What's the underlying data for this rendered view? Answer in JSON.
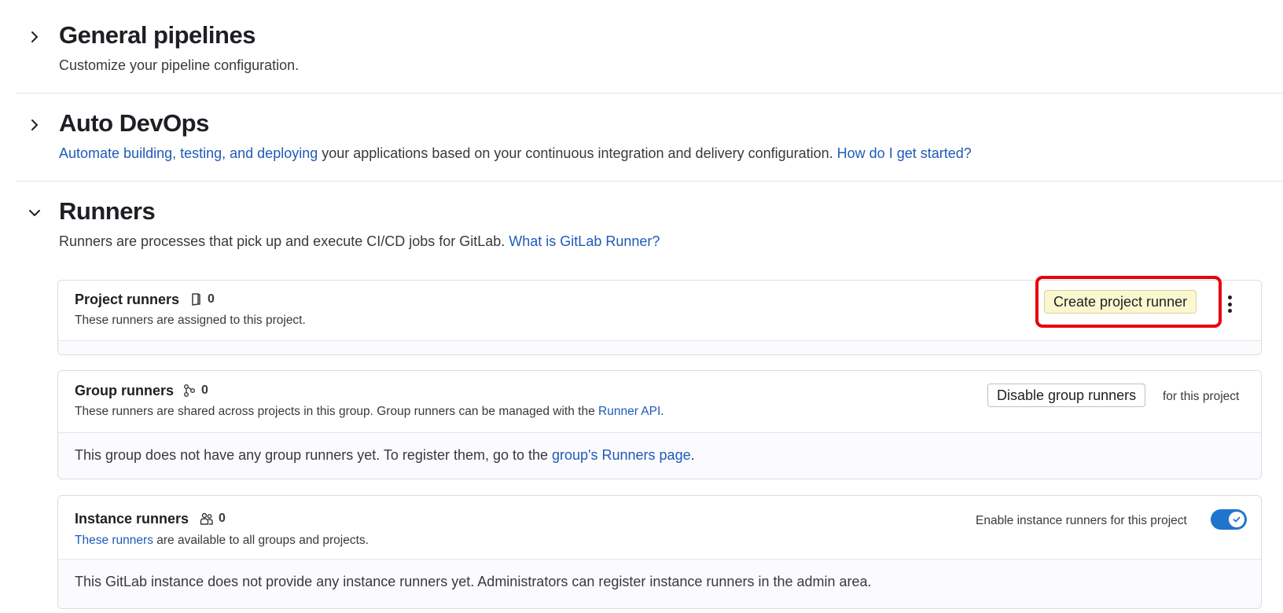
{
  "sections": {
    "general": {
      "title": "General pipelines",
      "description": "Customize your pipeline configuration."
    },
    "autodevops": {
      "title": "Auto DevOps",
      "link1": "Automate building, testing, and deploying",
      "text": " your applications based on your continuous integration and delivery configuration. ",
      "link2": "How do I get started?"
    },
    "runners": {
      "title": "Runners",
      "text": "Runners are processes that pick up and execute CI/CD jobs for GitLab. ",
      "link": "What is GitLab Runner?"
    }
  },
  "project_runners": {
    "title": "Project runners",
    "count": "0",
    "subtitle": "These runners are assigned to this project.",
    "create_button": "Create project runner",
    "more_actions_icon": "vertical-ellipsis-icon"
  },
  "group_runners": {
    "title": "Group runners",
    "count": "0",
    "subtitle": "These runners are shared across projects in this group. Group runners can be managed with the ",
    "subtitle_link": "Runner API",
    "subtitle_end": ".",
    "disable_button": "Disable group runners",
    "disable_suffix": "for this project",
    "empty_text": "This group does not have any group runners yet. To register them, go to the ",
    "empty_link": "group's Runners page",
    "empty_end": "."
  },
  "instance_runners": {
    "title": "Instance runners",
    "count": "0",
    "subtitle_link": "These runners",
    "subtitle": " are available to all groups and projects.",
    "toggle_label": "Enable instance runners for this project",
    "toggle_on": true,
    "empty_text": "This GitLab instance does not provide any instance runners yet. Administrators can register instance runners in the admin area."
  },
  "colors": {
    "link": "#1f5ab8",
    "highlight_outline": "#e8000b",
    "toggle_on": "#1f75cb"
  }
}
